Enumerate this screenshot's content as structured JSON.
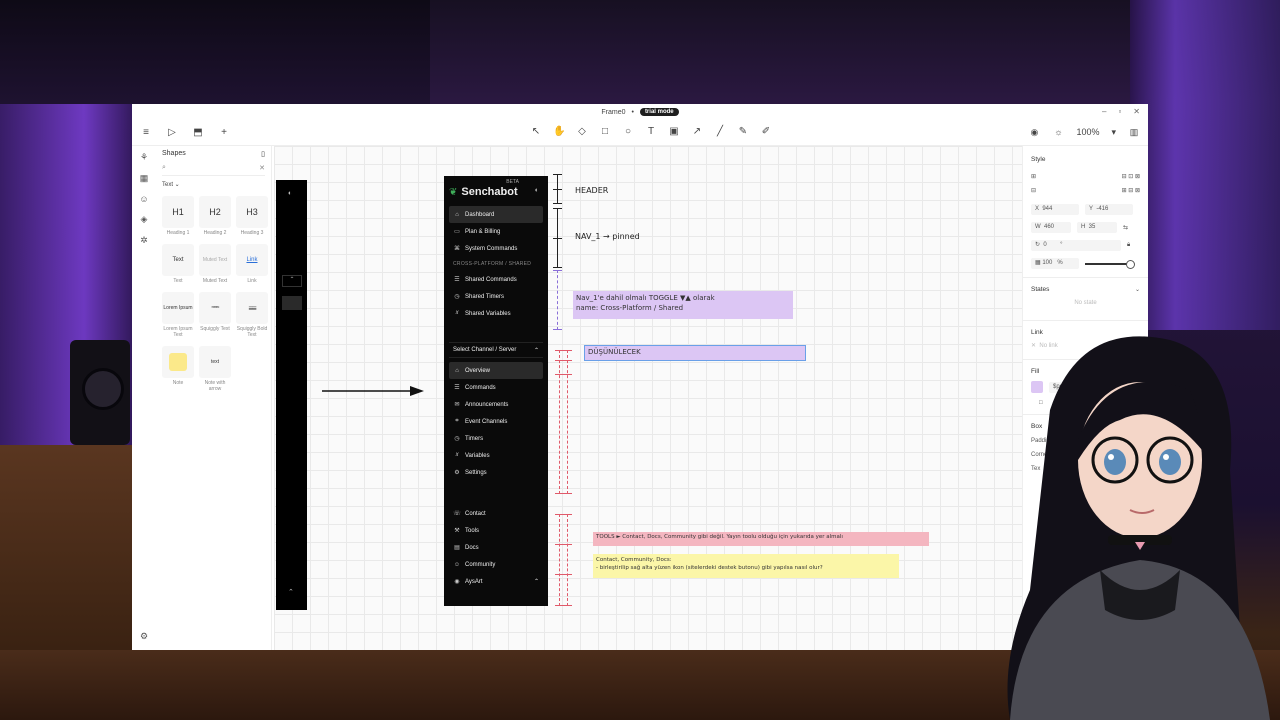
{
  "window": {
    "title": "Frame0",
    "title_marker": "•",
    "trial_badge": "trial mode"
  },
  "toolbar": {
    "left_icons": [
      "menu-icon",
      "play-icon",
      "cube-icon",
      "plus-icon"
    ],
    "center_tools": [
      "pointer-icon",
      "hand-icon",
      "eraser-icon",
      "rectangle-icon",
      "ellipse-icon",
      "text-icon",
      "image-icon",
      "arrow-icon",
      "line-icon",
      "pen-icon",
      "highlighter-icon"
    ],
    "zoom": "100%"
  },
  "shapes_panel": {
    "title": "Shapes",
    "filter": "Text",
    "items": [
      {
        "glyph": "H1",
        "label": "Heading 1"
      },
      {
        "glyph": "H2",
        "label": "Heading 2"
      },
      {
        "glyph": "H3",
        "label": "Heading 3"
      },
      {
        "glyph": "Text",
        "label": "Text"
      },
      {
        "glyph": "Muted Text",
        "label": "Muted Text"
      },
      {
        "glyph": "Link",
        "label": "Link"
      },
      {
        "glyph": "Lorem Ipsum",
        "label": "Lorem Ipsum Text"
      },
      {
        "glyph": "",
        "label": "Squiggly Text"
      },
      {
        "glyph": "",
        "label": "Squiggly Bold Text"
      },
      {
        "glyph": "",
        "label": "Note"
      },
      {
        "glyph": "text",
        "label": "Note with arrow"
      }
    ]
  },
  "senchabot": {
    "brand": "Senchabot",
    "beta": "BETA",
    "top_nav": [
      "Dashboard",
      "Plan & Billing",
      "System Commands"
    ],
    "cross_section": "CROSS-PLATFORM / SHARED",
    "cross_nav": [
      "Shared Commands",
      "Shared Timers",
      "Shared Variables"
    ],
    "channel_select": "Select Channel / Server",
    "channel_nav": [
      "Overview",
      "Commands",
      "Announcements",
      "Event Channels",
      "Timers",
      "Variables",
      "Settings"
    ],
    "bottom_nav": [
      "Contact",
      "Tools",
      "Docs",
      "Community",
      "AysArt"
    ]
  },
  "annotations": {
    "header": "HEADER",
    "nav1": "NAV_1 → pinned",
    "toggle_note_line1": "Nav_1'e dahil olmalı TOGGLE ▼▲ olarak",
    "toggle_note_line2": "name: Cross-Platform / Shared",
    "dusunulecek": "DÜŞÜNÜLECEK",
    "tools_note": "TOOLS ► Contact, Docs, Community gibi değil. Yayın toolu olduğu için yukarıda yer almalı",
    "contact_note_line1": "Contact, Community, Docs:",
    "contact_note_line2": "- birleştirilip sağ alta yüzen ikon (sitelerdeki destek butonu) gibi yapılsa nasıl olur?"
  },
  "props": {
    "style_title": "Style",
    "x": "944",
    "y": "-416",
    "w": "460",
    "h": "35",
    "rotation": "0",
    "rotation_unit": "°",
    "opacity": "100",
    "opacity_unit": "%",
    "states_title": "States",
    "states_empty": "No state",
    "link_title": "Link",
    "link_empty": "No link",
    "fill_title": "Fill",
    "fill_value": "$purp",
    "box_title": "Box",
    "padding_label": "Padding",
    "corner_label": "Corner",
    "text_label": "Tex"
  },
  "colors": {
    "sticky_purple": "#dcc6f4",
    "sticky_red": "#f4b6c0",
    "sticky_yellow": "#fbf6a8",
    "sidebar_bg": "#0a0a0a"
  }
}
